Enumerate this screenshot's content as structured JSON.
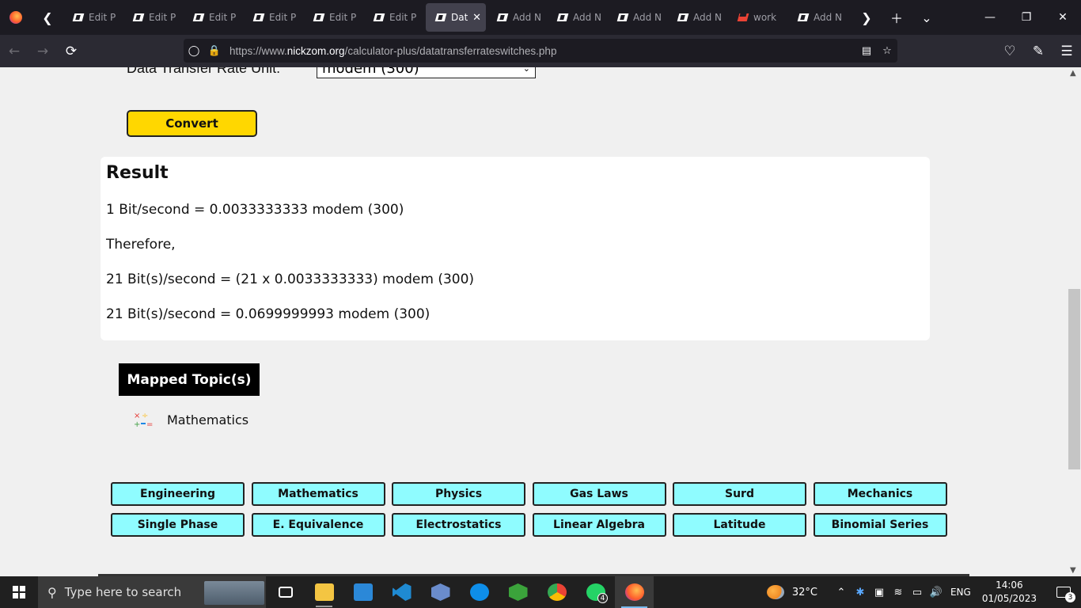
{
  "browser": {
    "tabs": [
      {
        "label": "Edit P",
        "active": false,
        "icon": "nickzom-icon"
      },
      {
        "label": "Edit P",
        "active": false,
        "icon": "nickzom-icon"
      },
      {
        "label": "Edit P",
        "active": false,
        "icon": "nickzom-icon"
      },
      {
        "label": "Edit P",
        "active": false,
        "icon": "nickzom-icon"
      },
      {
        "label": "Edit P",
        "active": false,
        "icon": "nickzom-icon"
      },
      {
        "label": "Edit P",
        "active": false,
        "icon": "nickzom-icon"
      },
      {
        "label": "Dat",
        "active": true,
        "icon": "nickzom-icon"
      },
      {
        "label": "Add N",
        "active": false,
        "icon": "nickzom-icon"
      },
      {
        "label": "Add N",
        "active": false,
        "icon": "nickzom-icon"
      },
      {
        "label": "Add N",
        "active": false,
        "icon": "nickzom-icon"
      },
      {
        "label": "Add N",
        "active": false,
        "icon": "nickzom-icon"
      },
      {
        "label": "work",
        "active": false,
        "icon": "gmail-icon"
      },
      {
        "label": "Add N",
        "active": false,
        "icon": "nickzom-icon"
      }
    ],
    "url_prefix": "https://www.",
    "url_domain": "nickzom.org",
    "url_path": "/calculator-plus/datatransferrateswitches.php"
  },
  "page": {
    "unit_label": "Data Transfer Rate Unit:",
    "unit_selected": "modem (300)",
    "convert_label": "Convert",
    "result": {
      "title": "Result",
      "lines": [
        "1 Bit/second = 0.0033333333 modem (300)",
        "Therefore,",
        "21 Bit(s)/second = (21 x 0.0033333333) modem (300)",
        "21 Bit(s)/second = 0.0699999993 modem (300)"
      ]
    },
    "mapped_topics_heading": "Mapped Topic(s)",
    "topic": "Mathematics",
    "categories": [
      "Engineering",
      "Mathematics",
      "Physics",
      "Gas Laws",
      "Surd",
      "Mechanics",
      "Single Phase",
      "E. Equivalence",
      "Electrostatics",
      "Linear Algebra",
      "Latitude",
      "Binomial Series"
    ],
    "colors": {
      "convert_bg": "#ffd700",
      "category_bg": "#8ffcff"
    }
  },
  "taskbar": {
    "search_placeholder": "Type here to search",
    "whatsapp_badge": "4",
    "weather": "32°C",
    "lang": "ENG",
    "time": "14:06",
    "date": "01/05/2023",
    "notification_count": "3"
  }
}
